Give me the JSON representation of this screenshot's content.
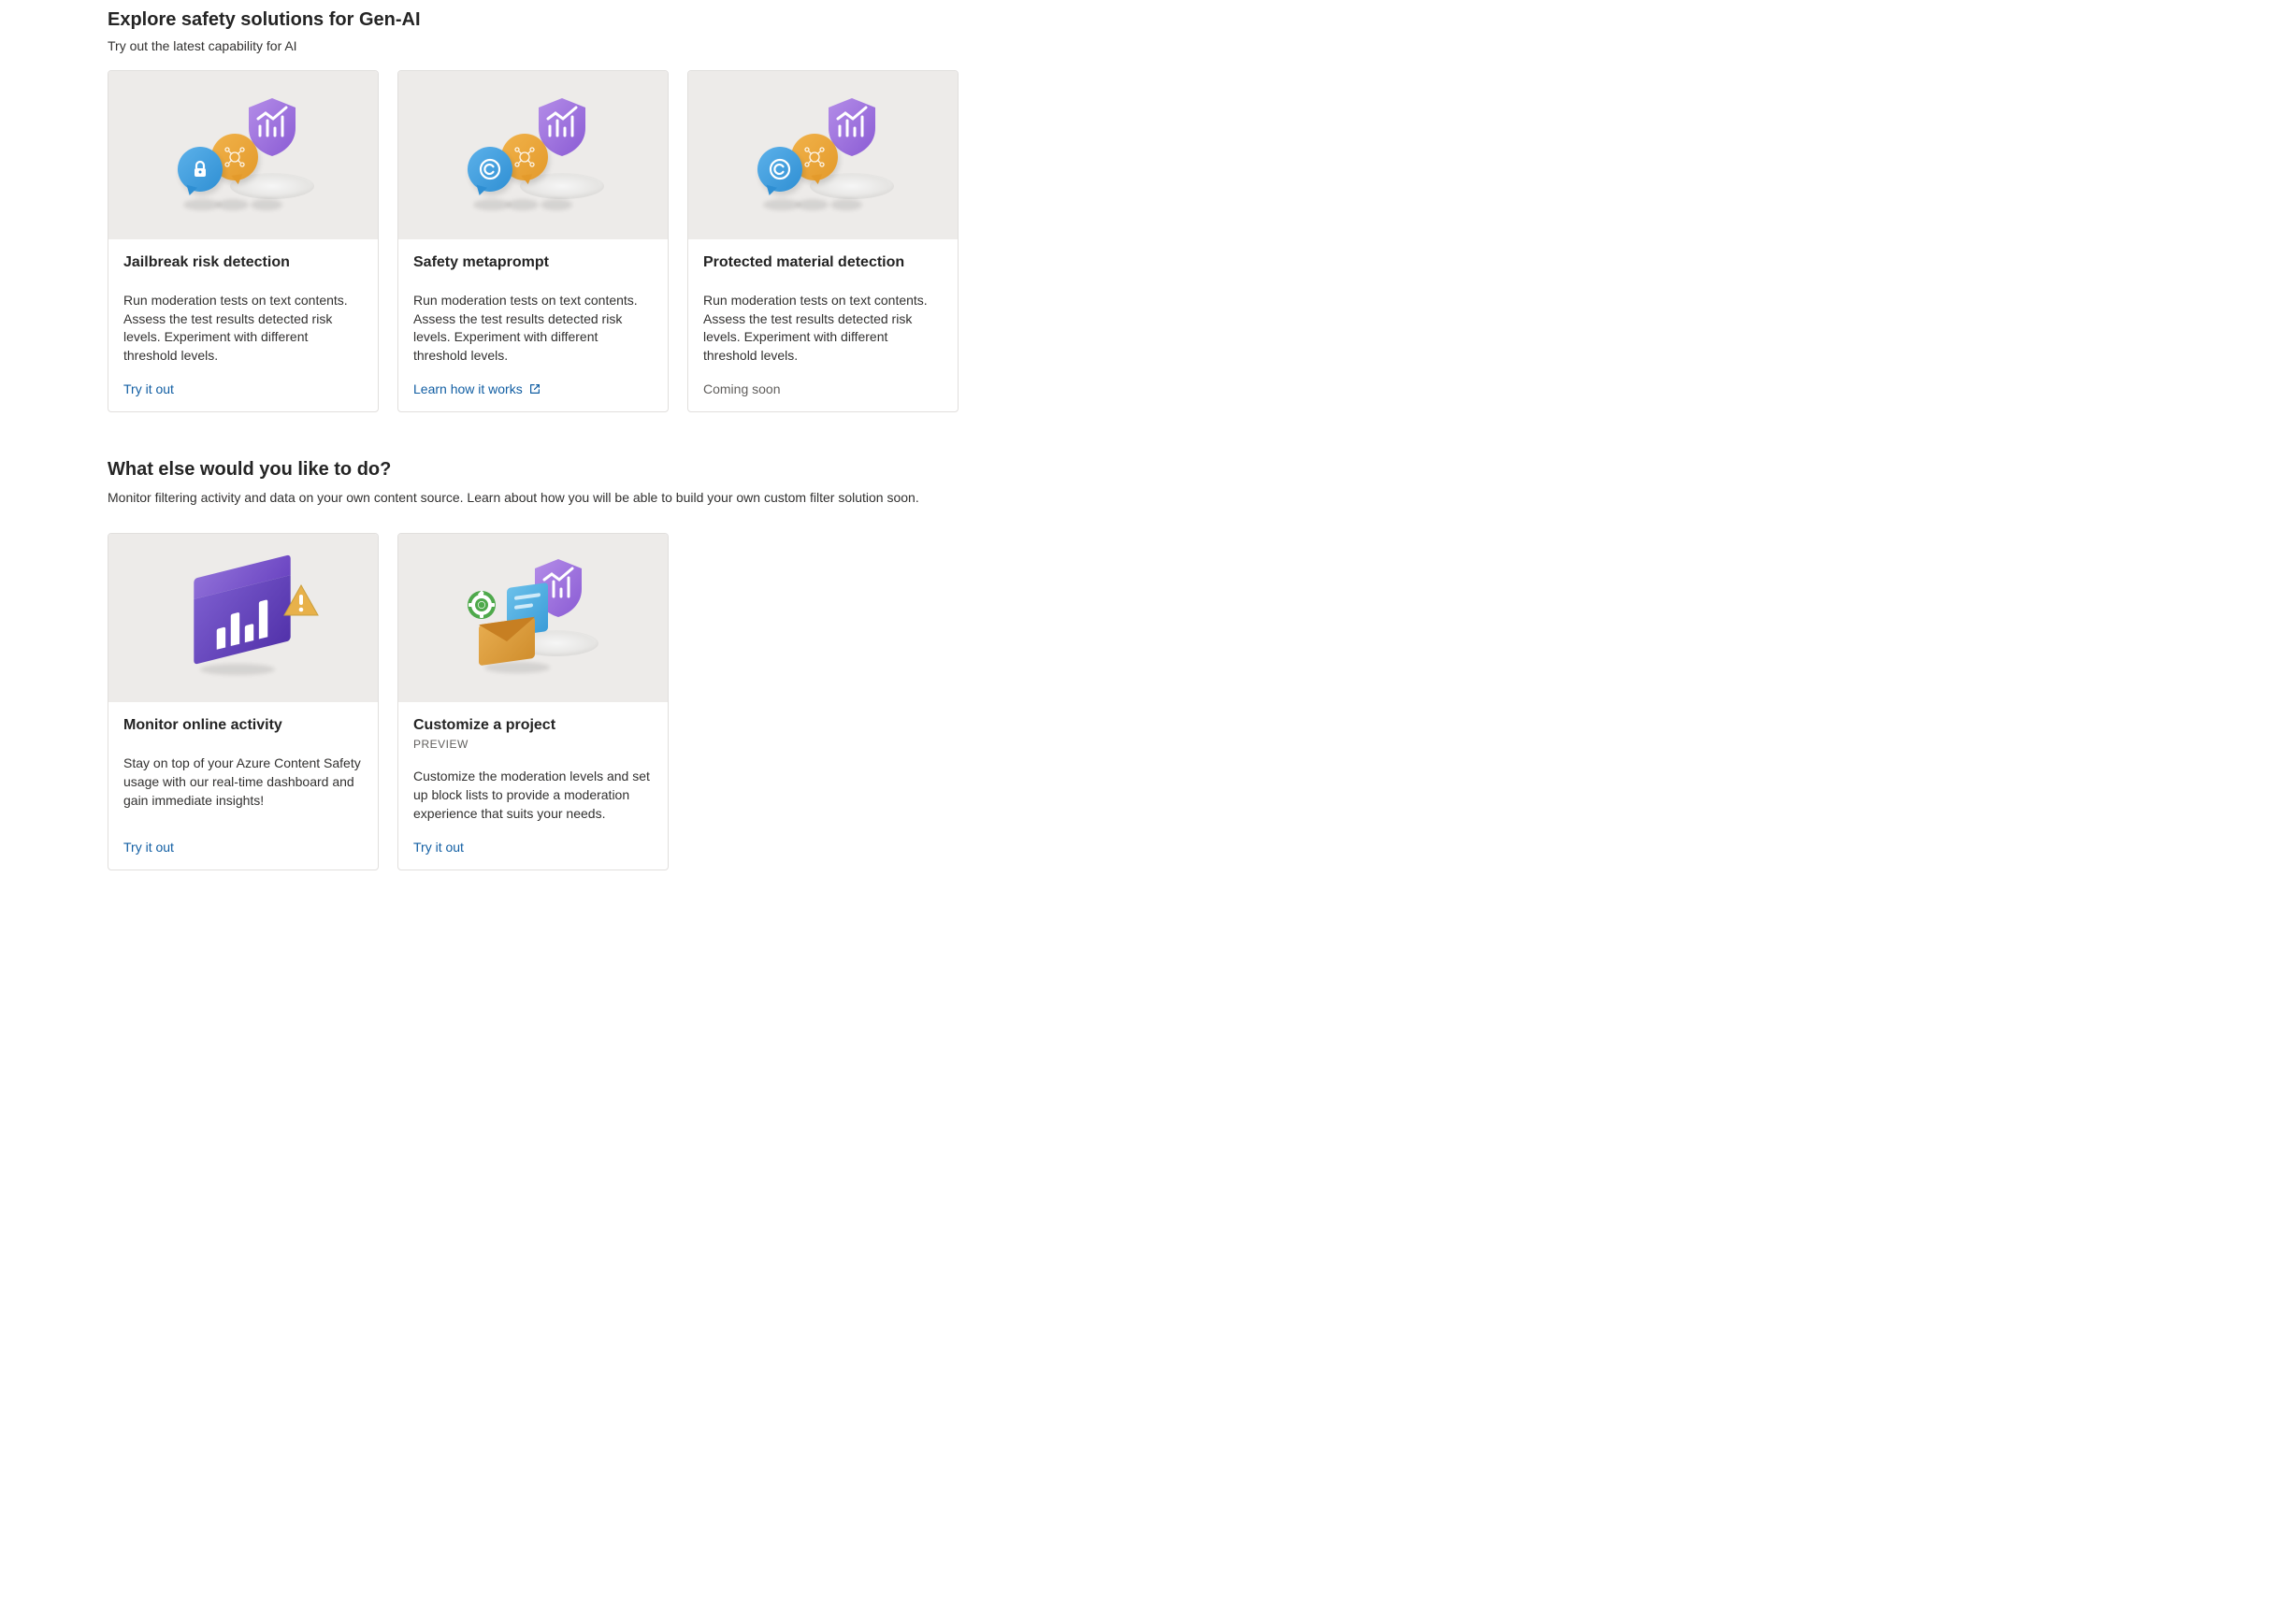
{
  "section1": {
    "title": "Explore safety solutions for Gen-AI",
    "subtitle": "Try out the latest capability for AI",
    "cards": [
      {
        "title": "Jailbreak risk detection",
        "desc": "Run moderation tests on text contents. Assess the test results detected risk levels. Experiment with different threshold levels.",
        "action": "Try it out",
        "action_type": "link",
        "highlighted": true,
        "icon_variant": "lock"
      },
      {
        "title": "Safety metaprompt",
        "desc": "Run moderation tests on text contents. Assess the test results detected risk levels. Experiment with different threshold levels.",
        "action": "Learn how it works",
        "action_type": "external",
        "highlighted": false,
        "icon_variant": "copyright"
      },
      {
        "title": "Protected material detection",
        "desc": "Run moderation tests on text contents. Assess the test results detected risk levels. Experiment with different threshold levels.",
        "action": "Coming soon",
        "action_type": "disabled",
        "highlighted": false,
        "icon_variant": "copyright"
      }
    ]
  },
  "section2": {
    "title": "What else would you like to do?",
    "subtitle": "Monitor filtering activity and data on your own content source. Learn about how you will be able to build your own custom filter solution soon.",
    "cards": [
      {
        "title": "Monitor online activity",
        "badge": "",
        "desc": "Stay on top of your Azure Content Safety usage with our real-time dashboard and gain immediate insights!",
        "action": "Try it out",
        "illustration": "monitor"
      },
      {
        "title": "Customize a project",
        "badge": "PREVIEW",
        "desc": "Customize the moderation levels and set up block lists to provide a moderation experience that suits your needs.",
        "action": "Try it out",
        "illustration": "customize"
      }
    ]
  },
  "colors": {
    "link": "#115ea3",
    "highlight_border": "#e1241a",
    "card_border": "#e1dfdd",
    "image_bg": "#edebe9"
  }
}
